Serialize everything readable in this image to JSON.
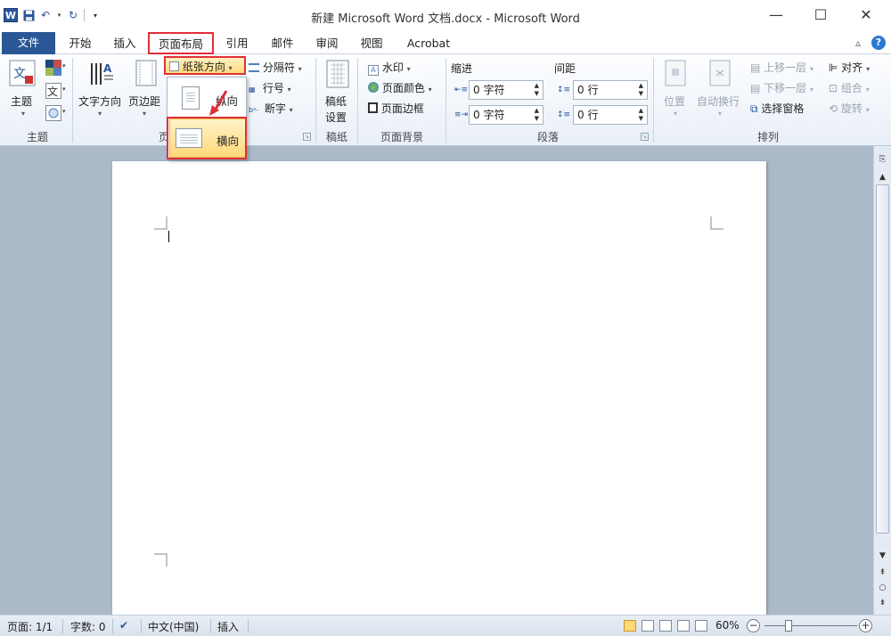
{
  "window": {
    "title": "新建 Microsoft Word 文档.docx - Microsoft Word",
    "app_logo": "W",
    "minimize": "—",
    "maximize": "☐",
    "close": "✕"
  },
  "tabs": {
    "file": "文件",
    "items": [
      "开始",
      "插入",
      "页面布局",
      "引用",
      "邮件",
      "审阅",
      "视图",
      "Acrobat"
    ],
    "active": "页面布局",
    "collapse": "▵",
    "help": "?"
  },
  "ribbon": {
    "themes": {
      "label": "主题",
      "theme_button": "主题"
    },
    "page_setup": {
      "text_direction": "文字方向",
      "margins": "页边距",
      "orientation": "纸张方向",
      "breaks": "分隔符",
      "line_numbers": "行号",
      "hyphenation": "断字",
      "group_label_partial": "页"
    },
    "manuscript": {
      "button_line1": "稿纸",
      "button_line2": "设置",
      "label": "稿纸"
    },
    "page_background": {
      "watermark": "水印",
      "page_color": "页面颜色",
      "page_borders": "页面边框",
      "label": "页面背景"
    },
    "paragraph": {
      "indent_label": "缩进",
      "spacing_label": "间距",
      "indent_left": "0 字符",
      "indent_right": "0 字符",
      "spacing_before": "0 行",
      "spacing_after": "0 行",
      "label": "段落"
    },
    "arrange": {
      "position": "位置",
      "wrap_text": "自动换行",
      "bring_forward": "上移一层",
      "send_backward": "下移一层",
      "selection_pane": "选择窗格",
      "align": "对齐",
      "group": "组合",
      "rotate": "旋转",
      "label": "排列"
    }
  },
  "orientation_menu": {
    "portrait": "纵向",
    "landscape": "横向",
    "hovered": "横向"
  },
  "statusbar": {
    "page": "页面: 1/1",
    "words": "字数: 0",
    "language": "中文(中国)",
    "mode": "插入",
    "zoom": "60%",
    "zoom_percent": 60
  },
  "colors": {
    "file_tab": "#2b5797",
    "highlight_red": "#e0303a",
    "hover_gold": "#ffd978",
    "doc_background": "#abb9c9"
  }
}
